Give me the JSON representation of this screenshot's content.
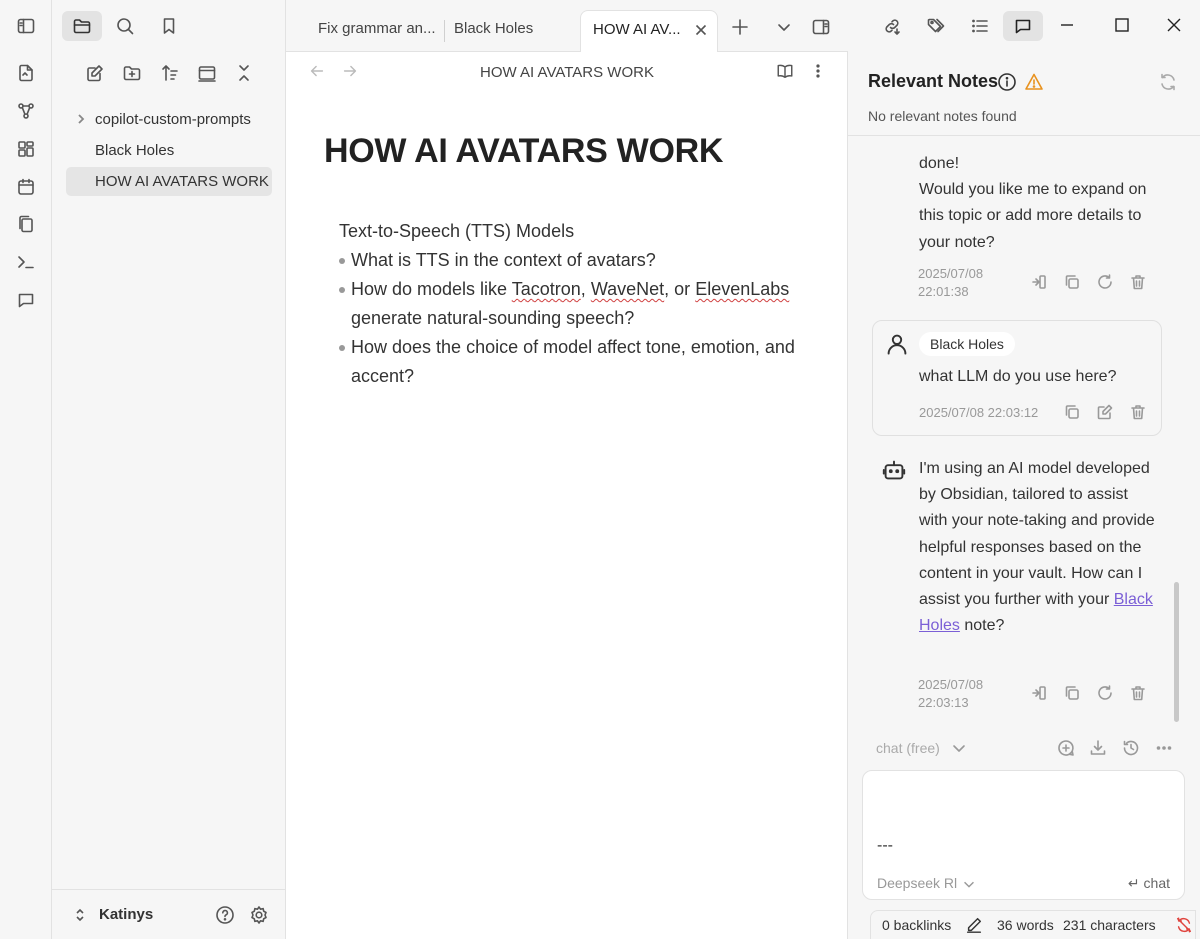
{
  "ribbon": {
    "icons": [
      "open-quick-switcher-icon",
      "graph-view-icon",
      "canvas-icon",
      "daily-note-icon",
      "templates-icon",
      "command-palette-icon",
      "chat-icon"
    ]
  },
  "sidebar": {
    "tree": [
      {
        "label": "copilot-custom-prompts",
        "type": "folder",
        "collapsed": true
      },
      {
        "label": "Black Holes",
        "type": "file"
      },
      {
        "label": "HOW AI AVATARS WORK",
        "type": "file",
        "active": true
      }
    ],
    "vault_name": "Katinys"
  },
  "tabs": [
    {
      "label": "Fix grammar an..."
    },
    {
      "label": "Black Holes"
    },
    {
      "label": "HOW AI AV...",
      "active": true
    }
  ],
  "editor": {
    "header_title": "HOW AI AVATARS WORK",
    "title": "HOW AI AVATARS WORK",
    "section_heading": "Text-to-Speech (TTS) Models",
    "bullets": {
      "b1": "What is TTS in the context of avatars?",
      "b2_prefix": "How do models like ",
      "b2_w1": "Tacotron",
      "b2_sep1": ", ",
      "b2_w2": "WaveNet",
      "b2_sep2": ", or ",
      "b2_w3": "ElevenLabs",
      "b2_suffix": " generate natural-sounding speech?",
      "b3": "How does the choice of model affect tone, emotion, and accent?"
    }
  },
  "relevant_notes": {
    "title": "Relevant Notes",
    "empty_text": "No relevant notes found"
  },
  "chat": {
    "msg1": {
      "text": "done!\nWould you like me to expand on this topic or add more details to your note?",
      "time_date": "2025/07/08",
      "time_clock": "22:01:38"
    },
    "msg2": {
      "context_chip": "Black Holes",
      "text": "what LLM do you use here?",
      "time": "2025/07/08 22:03:12"
    },
    "msg3": {
      "text_before": "I'm using an AI model developed by Obsidian, tailored to assist with your note-taking and provide helpful responses based on the content in your vault. How can I assist you further with your ",
      "link": "Black Holes",
      "text_after": " note?",
      "time_date": "2025/07/08",
      "time_clock": "22:03:13"
    },
    "toolbar": {
      "mode": "chat (free)"
    },
    "input": {
      "text": "---",
      "model": "Deepseek Rl",
      "send_label": "chat"
    }
  },
  "status": {
    "backlinks": "0 backlinks",
    "words": "36 words",
    "characters": "231 characters"
  },
  "colors": {
    "warning": "#e8921e",
    "link": "#7b5fd6",
    "sync_error": "#e0443e"
  }
}
